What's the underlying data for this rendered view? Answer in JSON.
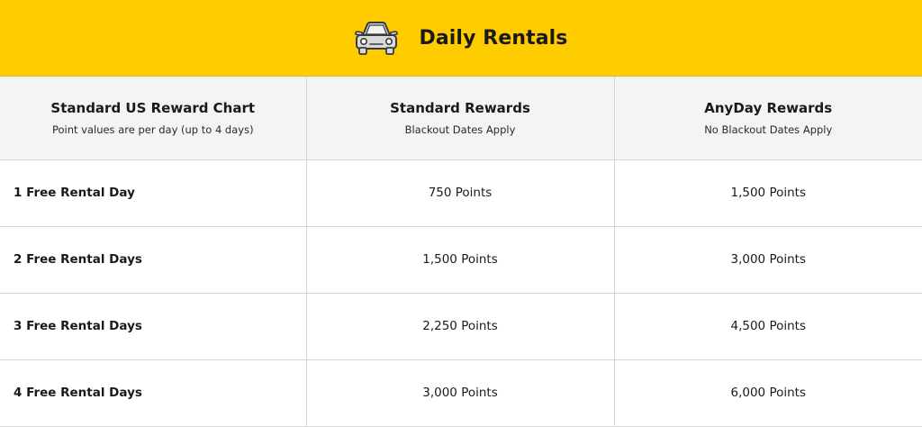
{
  "header": {
    "title": "Daily Rentals",
    "icon": "car-icon",
    "background_color": "#ffcc00"
  },
  "columns": [
    {
      "title": "Standard US Reward Chart",
      "subtitle": "Point values are per day (up to 4 days)"
    },
    {
      "title": "Standard Rewards",
      "subtitle": "Blackout Dates Apply"
    },
    {
      "title": "AnyDay Rewards",
      "subtitle": "No Blackout Dates Apply"
    }
  ],
  "rows": [
    {
      "label": "1 Free Rental Day",
      "standard": "750 Points",
      "anyday": "1,500 Points"
    },
    {
      "label": "2 Free Rental Days",
      "standard": "1,500 Points",
      "anyday": "3,000 Points"
    },
    {
      "label": "3 Free Rental Days",
      "standard": "2,250 Points",
      "anyday": "4,500 Points"
    },
    {
      "label": "4 Free Rental Days",
      "standard": "3,000 Points",
      "anyday": "6,000 Points"
    }
  ]
}
